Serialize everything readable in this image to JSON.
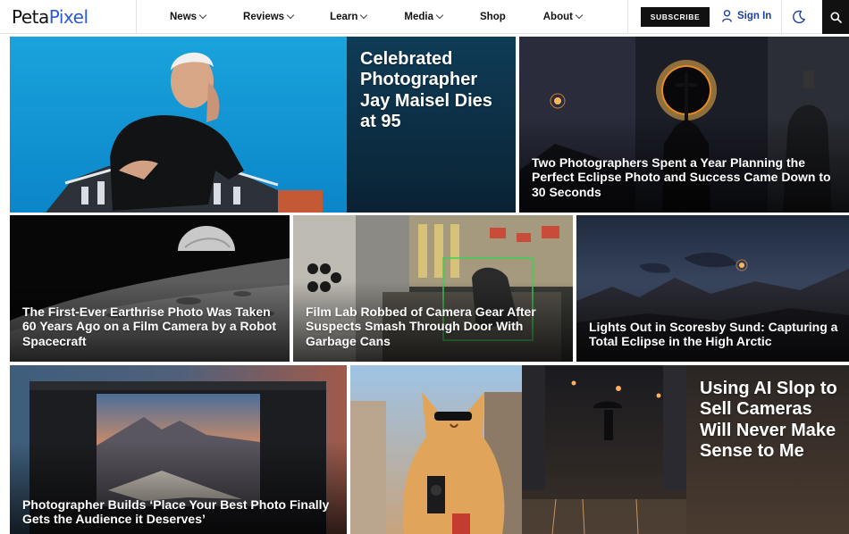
{
  "nav": {
    "logo_a": "Peta",
    "logo_b": "Pixel",
    "menu": [
      {
        "label": "News",
        "dropdown": true
      },
      {
        "label": "Reviews",
        "dropdown": true
      },
      {
        "label": "Learn",
        "dropdown": true
      },
      {
        "label": "Media",
        "dropdown": true
      },
      {
        "label": "Shop",
        "dropdown": false
      },
      {
        "label": "About",
        "dropdown": true
      }
    ],
    "subscribe": "SUBSCRIBE",
    "sign_in": "Sign In",
    "icons": {
      "user": "user-icon",
      "theme": "moon-icon",
      "search": "search-icon",
      "chevron": "chevron-down-icon"
    },
    "colors": {
      "brand_blue": "#2a5bd7",
      "signin_blue": "#1d3f9e",
      "dark": "#111111"
    }
  },
  "articles": [
    {
      "title": "Celebrated Photographer Jay Maisel Dies at 95",
      "image": "Jay Maisel portrait with building"
    },
    {
      "title": "Two Photographers Spent a Year Planning the Perfect Eclipse Photo and Success Came Down to 30 Seconds",
      "image": "Eclipse behind church cross"
    },
    {
      "title": "The First-Ever Earthrise Photo Was Taken 60 Years Ago on a Film Camera by a Robot Spacecraft",
      "image": "Earthrise over moon surface"
    },
    {
      "title": "Film Lab Robbed of Camera Gear After Suspects Smash Through Door With Garbage Cans",
      "image": "Security camera footage of film lab"
    },
    {
      "title": "Lights Out in Scoresby Sund: Capturing a Total Eclipse in the High Arctic",
      "image": "Arctic mountains eclipse twilight"
    },
    {
      "title": "Photographer Builds ‘Place Your Best Photo Finally Gets the Audience it Deserves’",
      "image": "Photo of mountains in dark frame"
    },
    {
      "title": "Using AI Slop to Sell Cameras Will Never Make Sense to Me",
      "image": "Cat with sunglasses and rainy street"
    }
  ]
}
